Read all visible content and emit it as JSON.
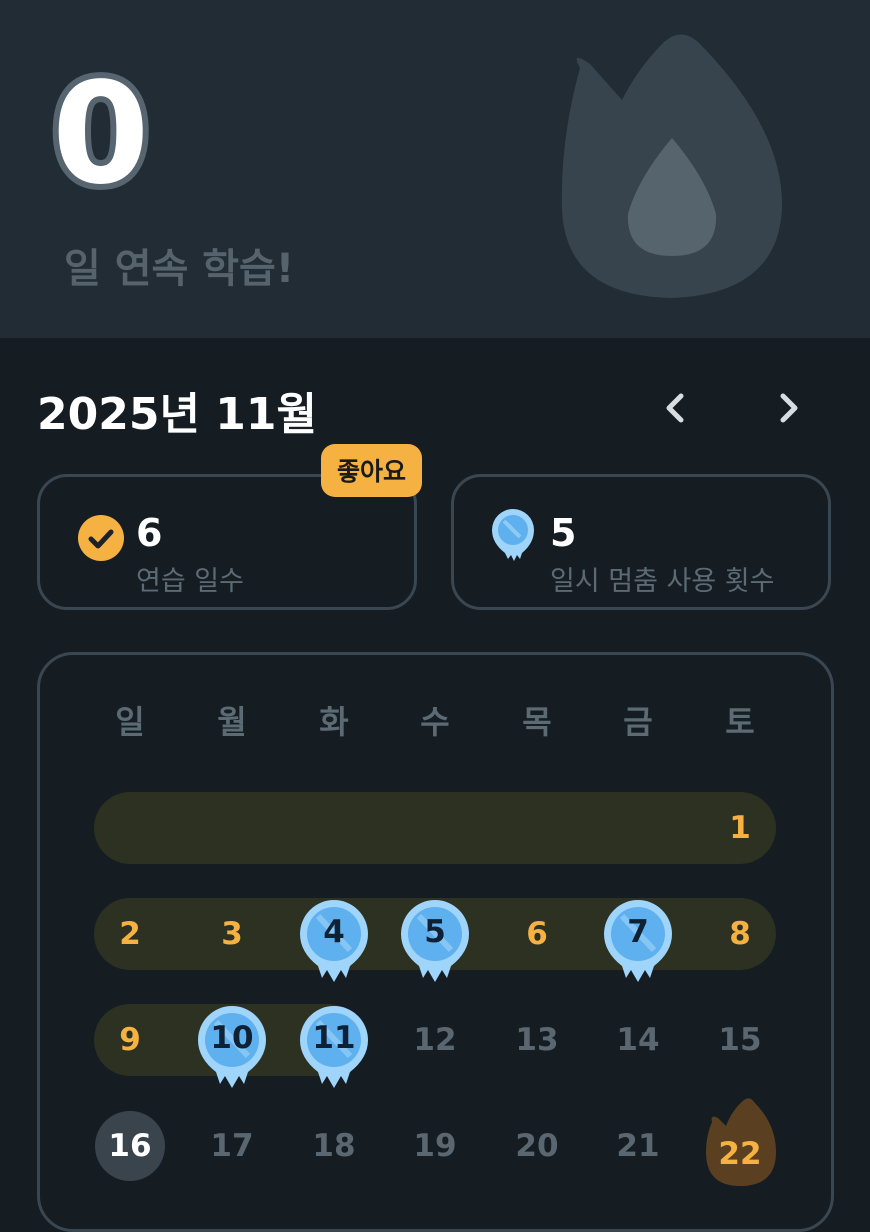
{
  "streak": {
    "count": "0",
    "label": "일 연속 학습!"
  },
  "calendar_header": {
    "month_title": "2025년 11월",
    "prev_icon": "chevron-left-icon",
    "next_icon": "chevron-right-icon"
  },
  "stats": {
    "practice": {
      "value": "6",
      "label": "연습 일수",
      "badge": "좋아요",
      "icon": "check-circle-icon"
    },
    "freeze": {
      "value": "5",
      "label": "일시 멈춤 사용 횟수",
      "icon": "streak-freeze-icon"
    }
  },
  "weekdays": [
    "일",
    "월",
    "화",
    "수",
    "목",
    "금",
    "토"
  ],
  "days": {
    "d1": "1",
    "d2": "2",
    "d3": "3",
    "d4": "4",
    "d5": "5",
    "d6": "6",
    "d7": "7",
    "d8": "8",
    "d9": "9",
    "d10": "10",
    "d11": "11",
    "d12": "12",
    "d13": "13",
    "d14": "14",
    "d15": "15",
    "d16": "16",
    "d17": "17",
    "d18": "18",
    "d19": "19",
    "d20": "20",
    "d21": "21",
    "d22": "22"
  },
  "colors": {
    "accent": "#f5b141",
    "freeze_blue": "#5fb0ee",
    "background": "#151d23",
    "hero_background": "#222c34"
  }
}
